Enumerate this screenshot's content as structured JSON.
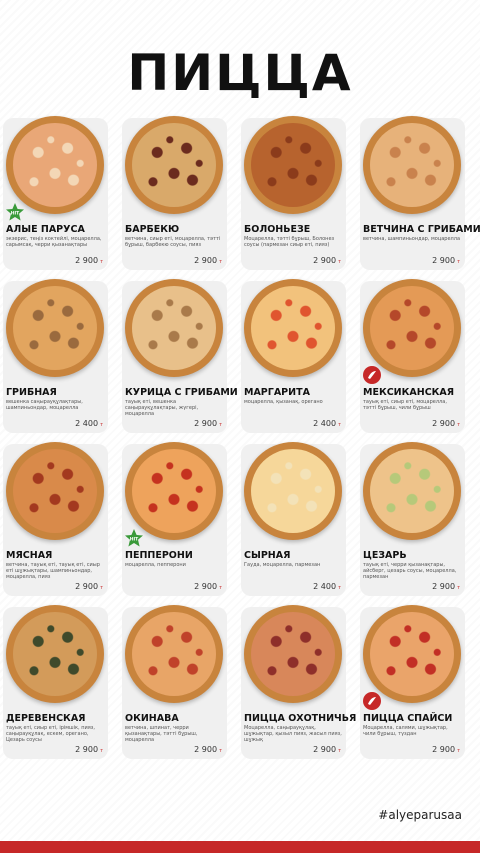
{
  "title": "ПИЦЦА",
  "hashtag": "#alyeparusaa",
  "currency": "т",
  "items": [
    {
      "name": "АЛЫЕ ПАРУСА",
      "desc": "экзерис, теңіз коктейлі, моцарелла, сарымсақ, черри қызанақтары",
      "price": "2 900",
      "badge": "hit",
      "topping": "#e9a777",
      "spot": "#f3d7b6"
    },
    {
      "name": "БАРБЕКЮ",
      "desc": "ветчина, сиыр еті, моцарелла, тәтті бұрыш, барбекю соусы, пияз",
      "price": "2 900",
      "badge": "",
      "topping": "#d9a96a",
      "spot": "#6b2b1e"
    },
    {
      "name": "БОЛОНЬЕЗЕ",
      "desc": "Моцарелла, тәтті бұрыш, Болонез соусы (пармезан сиыр еті, пияз)",
      "price": "2 900",
      "badge": "",
      "topping": "#b7632e",
      "spot": "#8b3b1b"
    },
    {
      "name": "ВЕТЧИНА С ГРИБАМИ",
      "desc": "ветчина, шампиньондар, моцарелла",
      "price": "2 900",
      "badge": "",
      "topping": "#e7b27a",
      "spot": "#c9824d"
    },
    {
      "name": "ГРИБНАЯ",
      "desc": "вешенка саңырауқұлақтары, шампиньондар, моцарелла",
      "price": "2 400",
      "badge": "",
      "topping": "#e2a55f",
      "spot": "#9a6a3e"
    },
    {
      "name": "КУРИЦА С ГРИБАМИ",
      "desc": "тауық еті, вешенка саңырауқұлақтары, жүгері, моцарелла",
      "price": "2 900",
      "badge": "",
      "topping": "#e8c08a",
      "spot": "#a97a4a"
    },
    {
      "name": "МАРГАРИТА",
      "desc": "моцарелла, қызанақ, орегано",
      "price": "2 400",
      "badge": "",
      "topping": "#f2c27c",
      "spot": "#e0552f"
    },
    {
      "name": "МЕКСИКАНСКАЯ",
      "desc": "тауық еті, сиыр еті, моцарелла, тәтті бұрыш, чили бұрыш",
      "price": "2 900",
      "badge": "spicy",
      "topping": "#e49a56",
      "spot": "#b5482a"
    },
    {
      "name": "МЯСНАЯ",
      "desc": "ветчина, тауық еті, тауық еті, сиыр еті шұжықтары, шампиньондар, моцарелла, пияз",
      "price": "2 900",
      "badge": "",
      "topping": "#d98a4a",
      "spot": "#a3391f"
    },
    {
      "name": "ПЕППЕРОНИ",
      "desc": "моцарелла, пепперони",
      "price": "2 900",
      "badge": "hit",
      "topping": "#eea35c",
      "spot": "#c5321f"
    },
    {
      "name": "СЫРНАЯ",
      "desc": "Гауда, моцарелла, пармезан",
      "price": "2 400",
      "badge": "",
      "topping": "#f6d79a",
      "spot": "#f3e2b8"
    },
    {
      "name": "ЦЕЗАРЬ",
      "desc": "тауық еті, черри қызанақтары, айсберг, цезарь соусы, моцарелла, пармезан",
      "price": "2 900",
      "badge": "",
      "topping": "#eec38a",
      "spot": "#b6c97a"
    },
    {
      "name": "ДЕРЕВЕНСКАЯ",
      "desc": "тауық еті, сиыр еті, ірімшік, пияз, саңырауқұлақ, ескем, орегано, Цезарь соусы",
      "price": "2 900",
      "badge": "",
      "topping": "#d39b5a",
      "spot": "#3f4a2b"
    },
    {
      "name": "ОКИНАВА",
      "desc": "ветчина, шпинат, черри қызанақтары, тәтті бұрыш, моцарелла",
      "price": "2 900",
      "badge": "",
      "topping": "#e8a567",
      "spot": "#c0422a"
    },
    {
      "name": "ПИЦЦА ОХОТНИЧЬЯ",
      "desc": "Моцарелла, саңырауқұлақ, шұжықтар, қызыл пияз, жасыл пияз, шұжық",
      "price": "2 900",
      "badge": "",
      "topping": "#d8875a",
      "spot": "#8e2f2a"
    },
    {
      "name": "ПИЦЦА СПАЙСИ",
      "desc": "Моцарелла, салями, шұжықтар, чили бұрыш, түздан",
      "price": "2 900",
      "badge": "spicy",
      "topping": "#eaa46a",
      "spot": "#c22f25"
    }
  ]
}
